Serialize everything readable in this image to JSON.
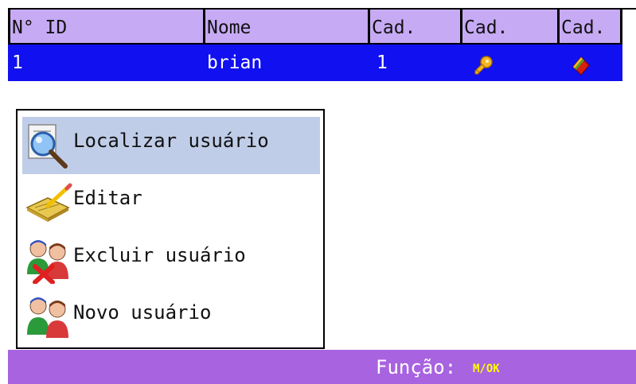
{
  "table": {
    "columns": [
      "N° ID",
      "Nome",
      "Cad.",
      "Cad.",
      "Cad."
    ],
    "rows": [
      {
        "id": "1",
        "name": "brian",
        "cad1": "1",
        "cad2_icon": "key-icon",
        "cad3_icon": "card-icon"
      }
    ],
    "selected_row_color": "#1010f0",
    "header_color": "#c7aaf4"
  },
  "menu": {
    "items": [
      {
        "label": "Localizar usuário",
        "icon": "magnifier-icon",
        "selected": true
      },
      {
        "label": "Editar",
        "icon": "edit-notepad-icon",
        "selected": false
      },
      {
        "label": "Excluir usuário",
        "icon": "delete-users-icon",
        "selected": false
      },
      {
        "label": "Novo usuário",
        "icon": "new-users-icon",
        "selected": false
      }
    ],
    "selected_color": "#c0cde8"
  },
  "footer": {
    "label": "Função:",
    "keys": "M/OK",
    "color": "#a863e0"
  }
}
